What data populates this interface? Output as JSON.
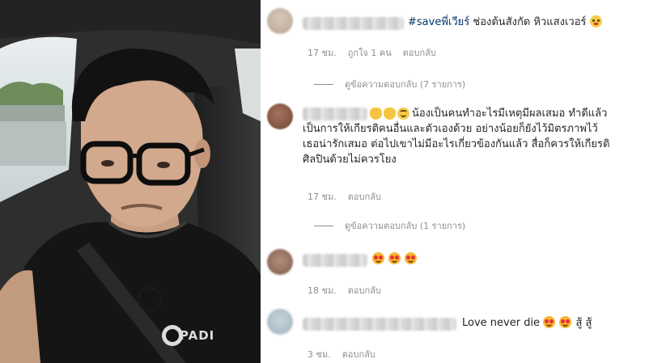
{
  "post_photo": {
    "shirt_logo_text": "PADI"
  },
  "comments": [
    {
      "hashtag": "#saveพี่เวียร์",
      "text": " ช่องต้นสังกัด หิวแสงเวอร์",
      "time": "17 ชม.",
      "likes": "ถูกใจ 1 คน",
      "reply": "ตอบกลับ",
      "view_replies": "ดูข้อความตอบกลับ (7 รายการ)"
    },
    {
      "text": "น้องเป็นคนทำอะไรมีเหตุมีผลเสมอ ทำดีแล้ว\nเป็นการให้เกียรติคนอื่นและตัวเองด้วย อย่างน้อยก็ยังไว้มิตรภาพไว้\nเธอน่ารักเสมอ ต่อไปเขาไม่มีอะไรเกี่ยวข้องกันแล้ว สื่อก็ควรให้เกียรติ\nศิลปินด้วยไม่ควรโยง",
      "time": "17 ชม.",
      "reply": "ตอบกลับ",
      "view_replies": "ดูข้อความตอบกลับ (1 รายการ)"
    },
    {
      "time": "18 ชม.",
      "reply": "ตอบกลับ"
    },
    {
      "text": "Love never die ",
      "text_suffix": "สู้ สู้",
      "time": "3 ชม.",
      "reply": "ตอบกลับ"
    }
  ],
  "icons": {
    "emoji_shy": "flushed-face-icon",
    "emoji_clap": "clapping-hands-icon",
    "emoji_thumbs": "thumbs-up-icon",
    "emoji_smile": "smiling-face-icon",
    "emoji_heart_eyes": "heart-eyes-icon"
  },
  "colors": {
    "text": "#262626",
    "meta": "#8e8e8e",
    "hashtag": "#00376b"
  }
}
